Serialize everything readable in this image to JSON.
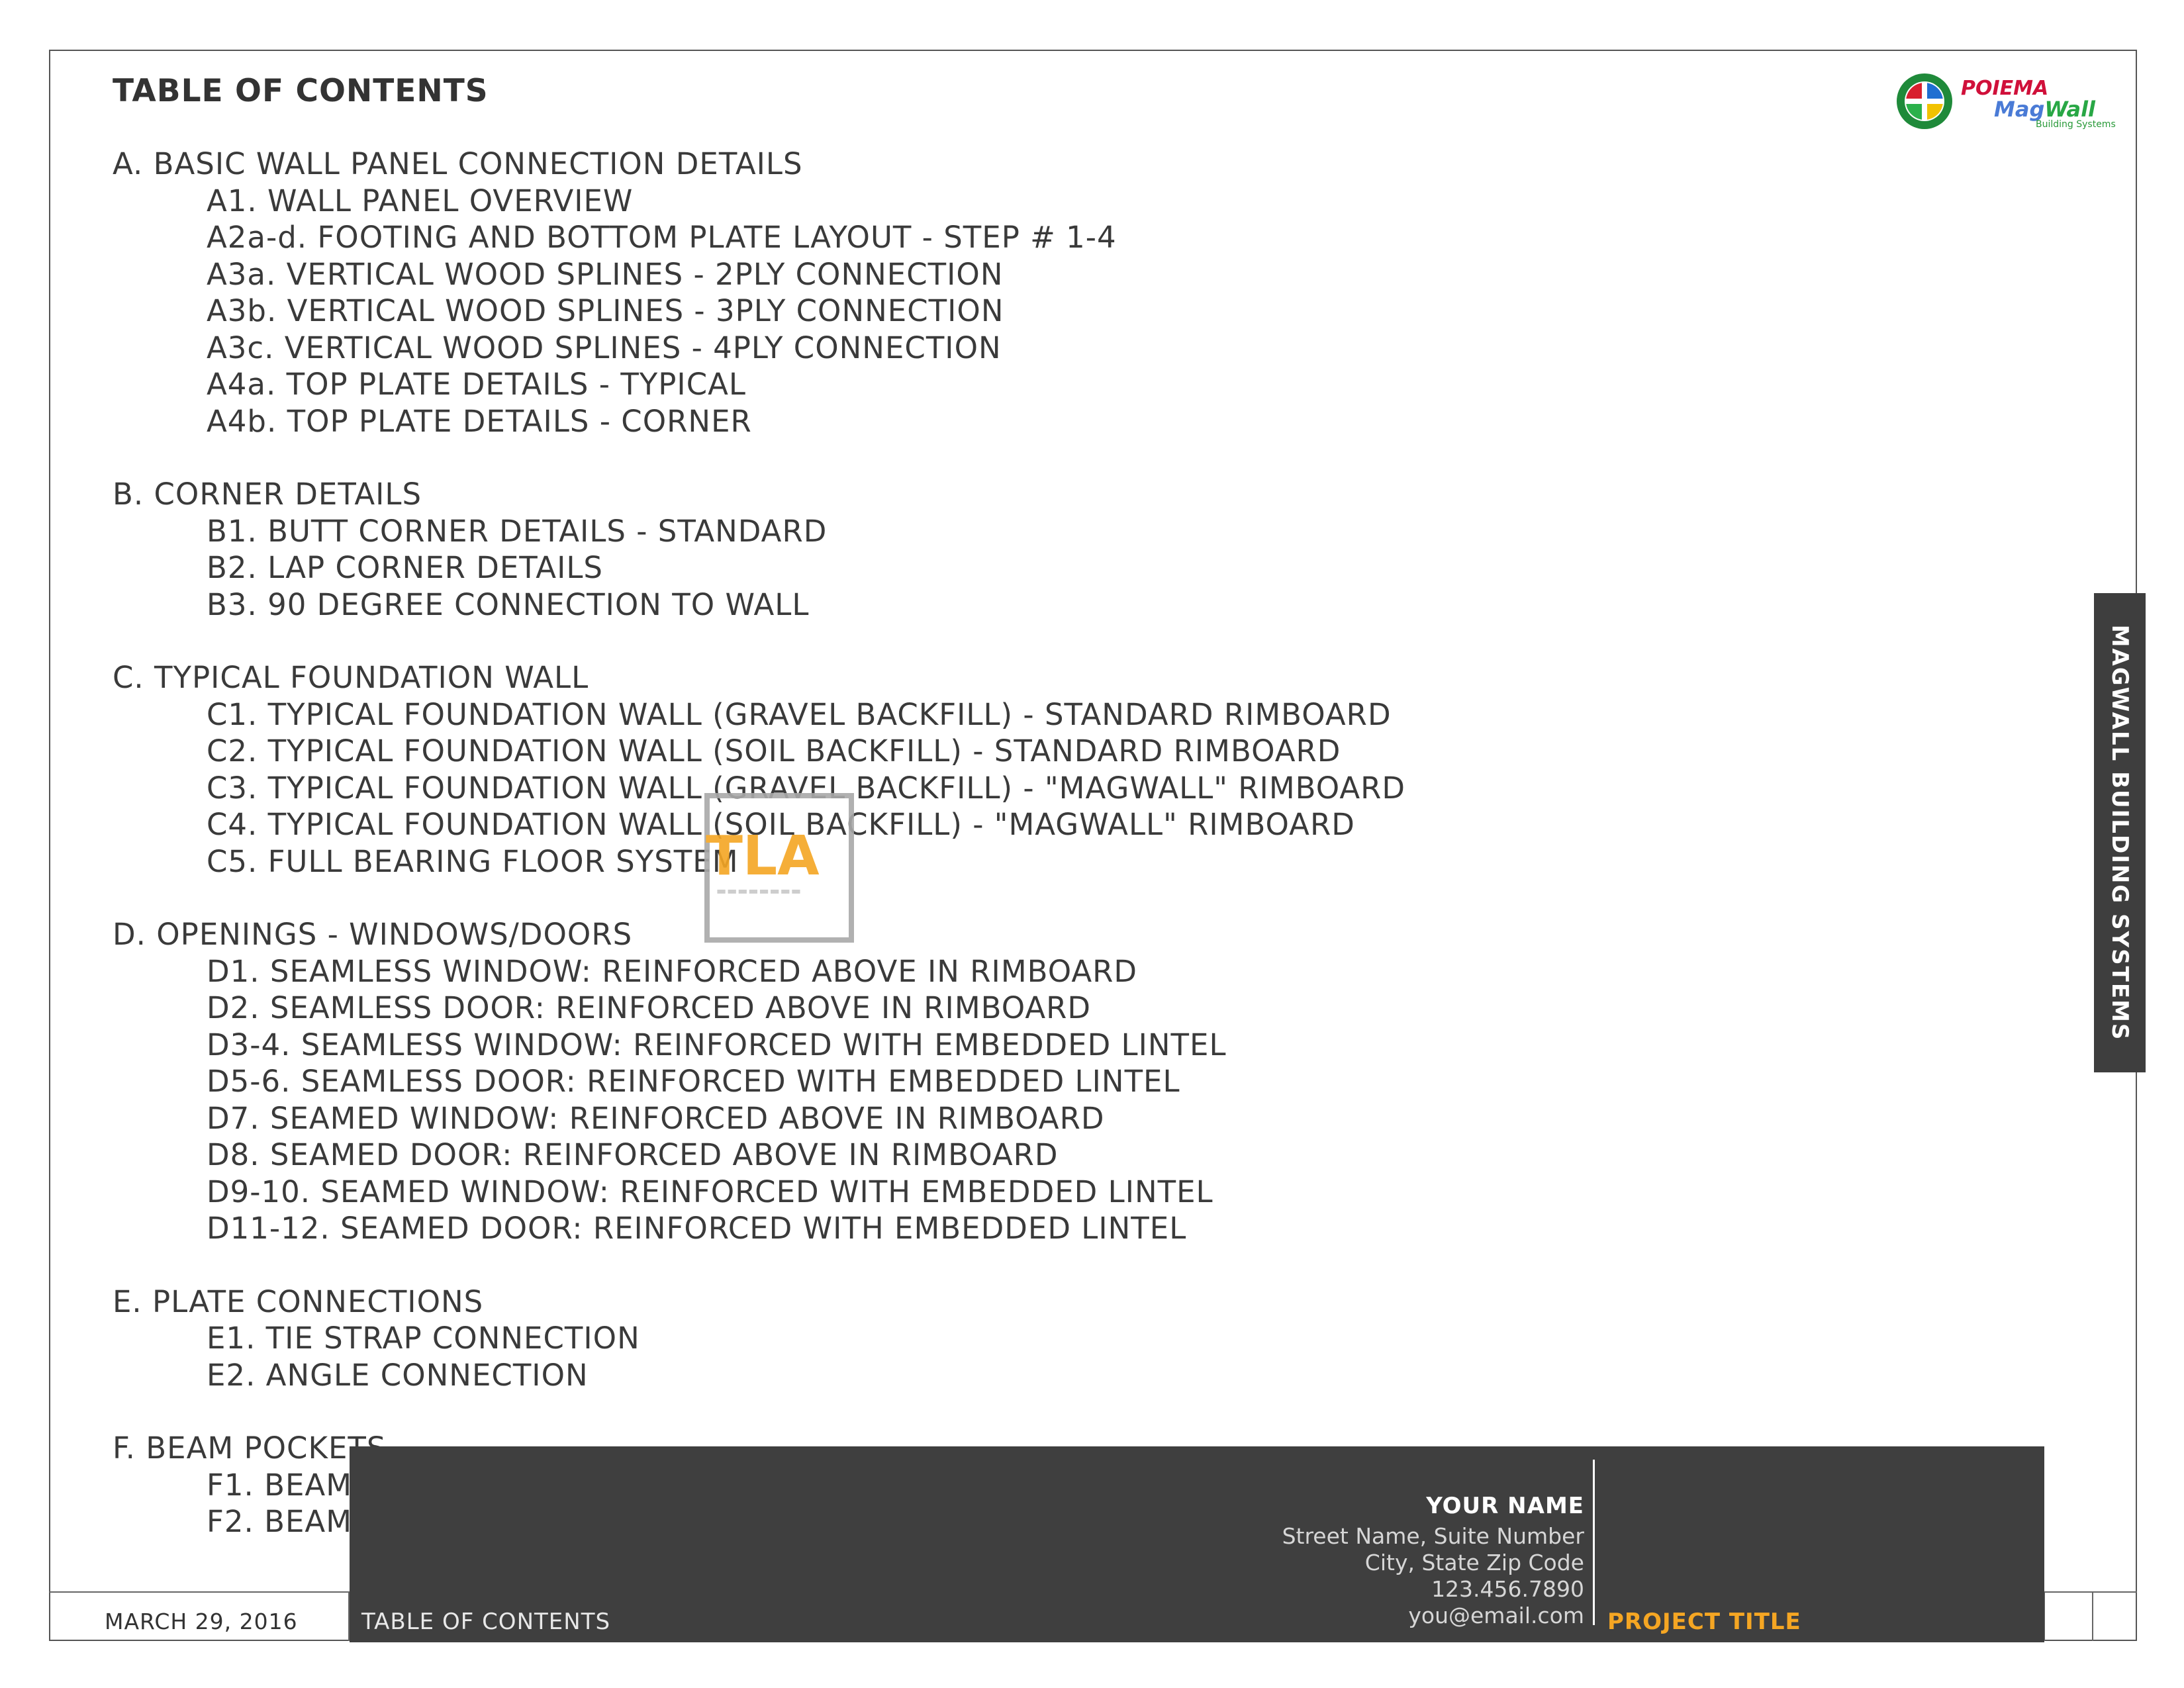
{
  "header": {
    "title": "TABLE OF CONTENTS"
  },
  "logo": {
    "brand_top": "POIEMA",
    "brand_mag": "Mag",
    "brand_wall": "Wall",
    "brand_sub": "Building Systems"
  },
  "side_tab": {
    "label": "MAGWALL BUILDING SYSTEMS"
  },
  "toc": {
    "sections": [
      {
        "heading": "A. BASIC WALL PANEL CONNECTION DETAILS",
        "items": [
          "A1. WALL PANEL OVERVIEW",
          "A2a-d. FOOTING AND BOTTOM PLATE LAYOUT - STEP # 1-4",
          "A3a. VERTICAL WOOD SPLINES - 2PLY CONNECTION",
          "A3b. VERTICAL WOOD SPLINES - 3PLY CONNECTION",
          "A3c. VERTICAL WOOD SPLINES - 4PLY CONNECTION",
          "A4a. TOP PLATE DETAILS - TYPICAL",
          "A4b. TOP PLATE DETAILS - CORNER"
        ]
      },
      {
        "heading": "B. CORNER DETAILS",
        "items": [
          "B1. BUTT CORNER DETAILS - STANDARD",
          "B2. LAP CORNER DETAILS",
          "B3. 90 DEGREE CONNECTION TO WALL"
        ]
      },
      {
        "heading": "C. TYPICAL FOUNDATION WALL",
        "items": [
          "C1. TYPICAL FOUNDATION WALL (GRAVEL BACKFILL) - STANDARD RIMBOARD",
          "C2. TYPICAL FOUNDATION WALL (SOIL BACKFILL) - STANDARD RIMBOARD",
          "C3. TYPICAL FOUNDATION WALL (GRAVEL BACKFILL) - \"MAGWALL\" RIMBOARD",
          "C4. TYPICAL FOUNDATION WALL (SOIL BACKFILL) - \"MAGWALL\" RIMBOARD",
          "C5. FULL BEARING FLOOR SYSTEM"
        ]
      },
      {
        "heading": "D. OPENINGS - WINDOWS/DOORS",
        "items": [
          "D1. SEAMLESS WINDOW: REINFORCED ABOVE IN RIMBOARD",
          "D2. SEAMLESS DOOR: REINFORCED ABOVE IN RIMBOARD",
          "D3-4. SEAMLESS WINDOW: REINFORCED WITH EMBEDDED LINTEL",
          "D5-6. SEAMLESS DOOR: REINFORCED WITH EMBEDDED LINTEL",
          "D7. SEAMED WINDOW: REINFORCED ABOVE IN RIMBOARD",
          "D8. SEAMED DOOR: REINFORCED ABOVE IN RIMBOARD",
          "D9-10. SEAMED WINDOW: REINFORCED WITH EMBEDDED LINTEL",
          "D11-12. SEAMED DOOR: REINFORCED WITH EMBEDDED LINTEL"
        ]
      },
      {
        "heading": "E. PLATE CONNECTIONS",
        "items": [
          "E1. TIE STRAP CONNECTION",
          "E2. ANGLE CONNECTION"
        ]
      },
      {
        "heading": "F. BEAM POCKETS",
        "items": [
          "F1. BEAM",
          "F2. BEAM"
        ]
      }
    ]
  },
  "footer": {
    "date": "MARCH 29, 2016",
    "sheet_title": "TABLE OF CONTENTS",
    "name": "YOUR NAME",
    "address1": "Street Name, Suite Number",
    "address2": "City, State Zip Code",
    "phone": "123.456.7890",
    "email": "you@email.com",
    "project": "PROJECT TITLE"
  },
  "watermark": {
    "text": "TLA"
  }
}
